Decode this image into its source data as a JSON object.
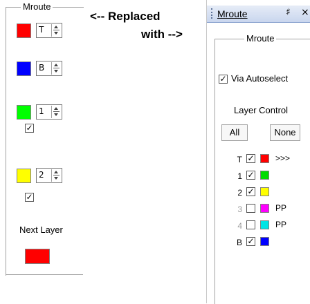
{
  "old_panel": {
    "title": "Mroute",
    "layers": [
      {
        "color": "#ff0000",
        "spin_value": "T"
      },
      {
        "color": "#0000ff",
        "spin_value": "B"
      },
      {
        "color": "#00ff00",
        "spin_value": "1"
      },
      {
        "color": "#ffff00",
        "spin_value": "2"
      }
    ],
    "check_mark": "✓",
    "next_layer_label": "Next Layer",
    "next_layer_color": "#ff0000"
  },
  "annotation": {
    "line1": "<-- Replaced",
    "line2": "with -->"
  },
  "new_panel": {
    "tab_title": "Mroute",
    "pin_icon": "pin-icon",
    "pin_glyph": "♯",
    "close_glyph": "×",
    "group_title": "Mroute",
    "via_autoselect_label": "Via Autoselect",
    "via_autoselect_checked": true,
    "layer_control_label": "Layer Control",
    "all_button": "All",
    "none_button": "None",
    "check_mark": "✓",
    "layers": [
      {
        "name": "T",
        "checked": true,
        "color": "#ff0000",
        "extra": ">>>",
        "dim": false
      },
      {
        "name": "1",
        "checked": true,
        "color": "#00dd00",
        "extra": "",
        "dim": false
      },
      {
        "name": "2",
        "checked": true,
        "color": "#ffff00",
        "extra": "",
        "dim": false
      },
      {
        "name": "3",
        "checked": false,
        "color": "#ff00ff",
        "extra": "PP",
        "dim": true
      },
      {
        "name": "4",
        "checked": false,
        "color": "#00e5e5",
        "extra": "PP",
        "dim": true
      },
      {
        "name": "B",
        "checked": true,
        "color": "#0000ff",
        "extra": "",
        "dim": false
      }
    ]
  }
}
